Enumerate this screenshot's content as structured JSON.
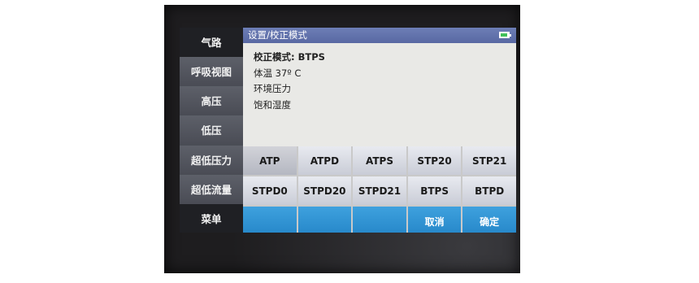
{
  "sidebar": {
    "items": [
      {
        "label": "气路"
      },
      {
        "label": "呼吸视图"
      },
      {
        "label": "高压"
      },
      {
        "label": "低压"
      },
      {
        "label": "超低压力"
      },
      {
        "label": "超低流量"
      },
      {
        "label": "菜单"
      }
    ]
  },
  "titlebar": {
    "title": "设置/校正模式"
  },
  "content": {
    "mode_line": "校正模式:  BTPS",
    "body_temp": "体温 37º C",
    "ambient_pressure": "环境压力",
    "saturation_humidity": "饱和湿度"
  },
  "options": {
    "row1": [
      "ATP",
      "ATPD",
      "ATPS",
      "STP20",
      "STP21"
    ],
    "row2": [
      "STPD0",
      "STPD20",
      "STPD21",
      "BTPS",
      "BTPD"
    ],
    "selected": "ATP"
  },
  "actions": {
    "cancel_label": "取消",
    "confirm_label": "确定"
  },
  "colors": {
    "titlebar": "#5f6fac",
    "action_bar": "#2e92d4",
    "battery": "#41c05a"
  },
  "icons": {
    "battery": "battery-icon"
  }
}
